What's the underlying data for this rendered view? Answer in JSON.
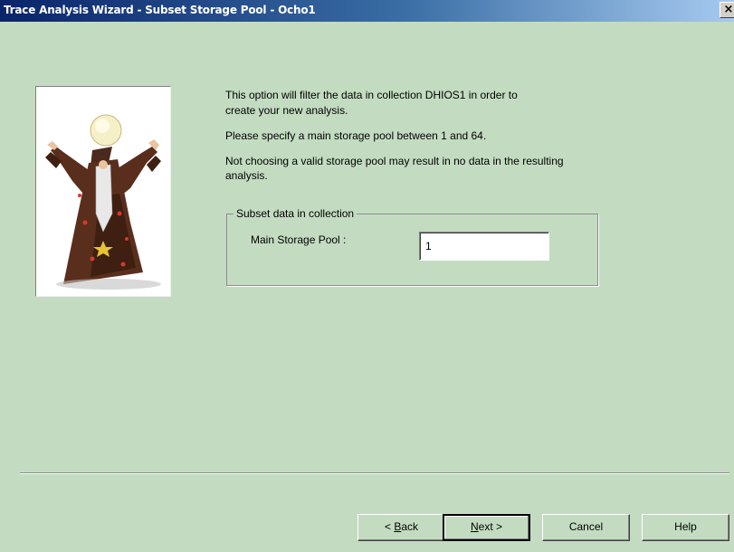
{
  "window": {
    "title": "Trace Analysis Wizard - Subset Storage Pool - Ocho1",
    "close_glyph": "×"
  },
  "instructions": {
    "line1": "This option will filter the data in collection DHIOS1 in order to",
    "line2": "create your new analysis.",
    "line3": "Please specify a main storage pool between 1 and 64.",
    "line4": "Not choosing a valid storage pool may result in no data in the resulting",
    "line5": "analysis."
  },
  "group": {
    "legend": "Subset data in collection",
    "field_label": "Main Storage Pool :",
    "field_value": "1"
  },
  "buttons": {
    "back_prefix": "< ",
    "back_mnemonic": "B",
    "back_rest": "ack",
    "next_mnemonic": "N",
    "next_rest": "ext >",
    "cancel": "Cancel",
    "help": "Help"
  },
  "colors": {
    "background": "#c3dcc1",
    "title_start": "#0a246a",
    "title_end": "#a6caf0"
  },
  "icons": {
    "wizard_image": "wizard-with-crystal-ball"
  }
}
